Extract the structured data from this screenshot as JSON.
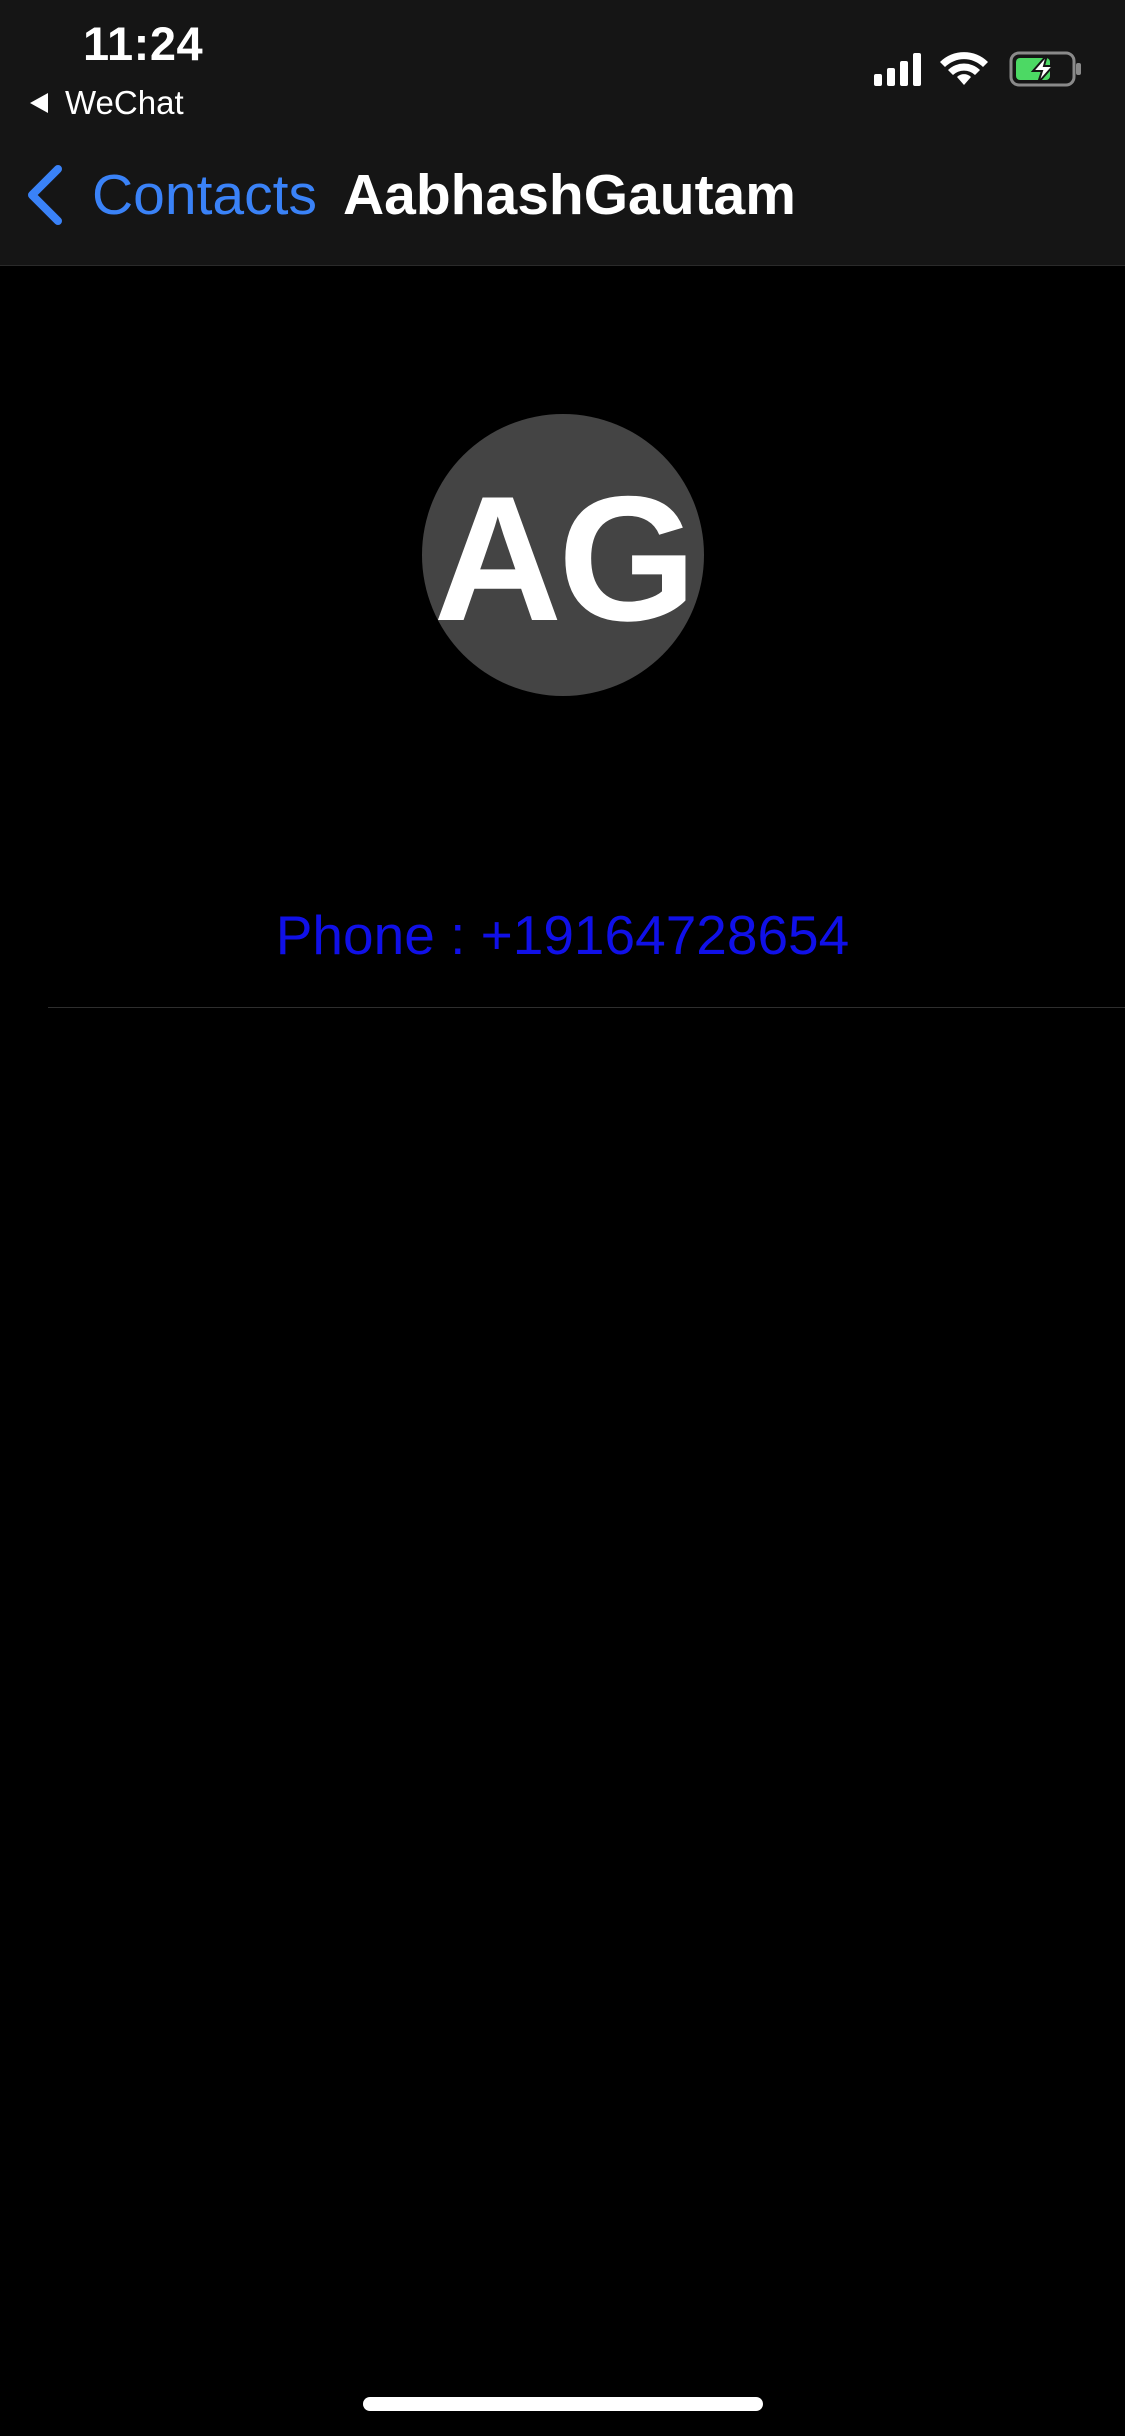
{
  "status_bar": {
    "time": "11:24",
    "back_app_label": "WeChat",
    "icons": [
      "cellular-signal-icon",
      "wifi-icon",
      "battery-charging-icon"
    ],
    "battery_color": "#4cd964"
  },
  "nav": {
    "back_label": "Contacts",
    "title": "AabhashGautam",
    "accent_color": "#3a82f7"
  },
  "contact": {
    "avatar_initials": "AG",
    "phone_text": "Phone : +19164728654",
    "phone_color": "#1010e8"
  }
}
